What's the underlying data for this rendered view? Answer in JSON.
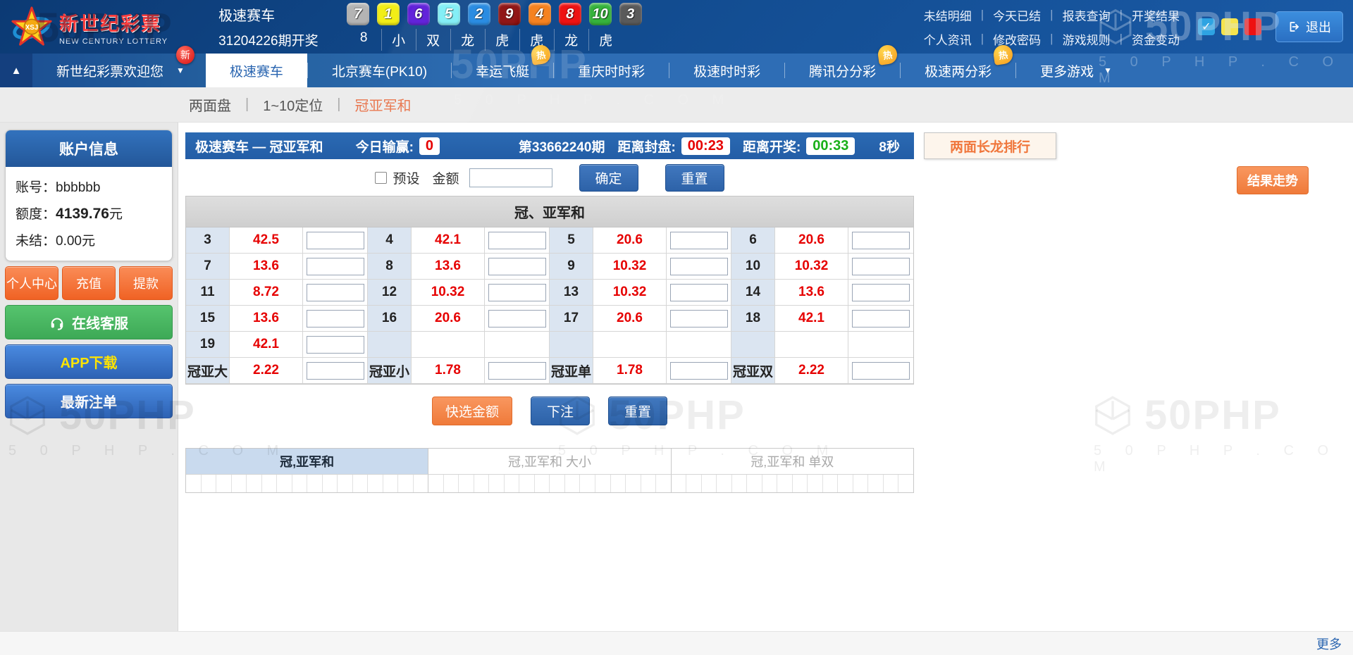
{
  "watermark": {
    "text": "50PHP",
    "sub": "5 0 P H P . C O M"
  },
  "header": {
    "logo": {
      "badge": "XSJ",
      "title": "新世纪彩票",
      "subtitle": "NEW CENTURY LOTTERY"
    },
    "game_name": "极速赛车",
    "draw_label": "31204226期开奖",
    "balls": [
      {
        "num": "7",
        "color": "#b4b4b4"
      },
      {
        "num": "1",
        "color": "#f2ee16"
      },
      {
        "num": "6",
        "color": "#5a17d8"
      },
      {
        "num": "5",
        "color": "#7deef5"
      },
      {
        "num": "2",
        "color": "#1f86e0"
      },
      {
        "num": "9",
        "color": "#8b0a0a"
      },
      {
        "num": "4",
        "color": "#f58220"
      },
      {
        "num": "8",
        "color": "#ee1212"
      },
      {
        "num": "10",
        "color": "#36b33c"
      },
      {
        "num": "3",
        "color": "#5a5a5a"
      }
    ],
    "results": [
      "8",
      "小",
      "双",
      "龙",
      "虎",
      "虎",
      "龙",
      "虎"
    ],
    "links_row1": [
      "未结明细",
      "今天已结",
      "报表查询",
      "开奖结果"
    ],
    "links_row2": [
      "个人资讯",
      "修改密码",
      "游戏规则",
      "资金变动"
    ],
    "theme_colors": [
      "#2ea3e2",
      "#f5e44e",
      "#ee1111"
    ],
    "logout_label": "退出"
  },
  "nav": {
    "collapse_icon": "▲",
    "welcome": "新世纪彩票欢迎您",
    "welcome_badge": "新",
    "tabs": [
      {
        "label": "极速赛车",
        "active": true
      },
      {
        "label": "北京赛车(PK10)"
      },
      {
        "label": "幸运飞艇",
        "hot": "热"
      },
      {
        "label": "重庆时时彩"
      },
      {
        "label": "极速时时彩"
      },
      {
        "label": "腾讯分分彩",
        "hot": "热"
      },
      {
        "label": "极速两分彩",
        "hot": "热"
      },
      {
        "label": "更多游戏",
        "caret": true
      }
    ]
  },
  "subnav": {
    "items": [
      {
        "label": "两面盘"
      },
      {
        "label": "1~10定位"
      },
      {
        "label": "冠亚军和",
        "active": true
      }
    ]
  },
  "sidebar": {
    "panel_title": "账户信息",
    "fields": [
      {
        "label": "账号：",
        "value": "bbbbbb",
        "suffix": "",
        "bold": false
      },
      {
        "label": "额度：",
        "value": "4139.76",
        "suffix": " 元",
        "bold": true
      },
      {
        "label": "未结：",
        "value": "0.00",
        "suffix": " 元",
        "bold": false
      }
    ],
    "buttons": [
      "个人中心",
      "充值",
      "提款"
    ],
    "service_button": "在线客服",
    "app_button": "APP下载",
    "orders_button": "最新注单"
  },
  "game_bar": {
    "title": "极速赛车 — 冠亚军和",
    "today_label": "今日输赢:",
    "today_value": "0",
    "period": "第33662240期",
    "close_label": "距离封盘:",
    "close_time": "00:23",
    "open_label": "距离开奖:",
    "open_time": "00:33",
    "seconds": "8秒",
    "dragon_button": "两面长龙排行"
  },
  "bet_controls": {
    "preset_label": "预设",
    "amount_label": "金额",
    "confirm": "确定",
    "reset": "重置",
    "trend_button": "结果走势"
  },
  "bet_table": {
    "title": "冠、亚军和",
    "rows": [
      [
        {
          "label": "3",
          "odds": "42.5"
        },
        {
          "label": "4",
          "odds": "42.1"
        },
        {
          "label": "5",
          "odds": "20.6"
        },
        {
          "label": "6",
          "odds": "20.6"
        }
      ],
      [
        {
          "label": "7",
          "odds": "13.6"
        },
        {
          "label": "8",
          "odds": "13.6"
        },
        {
          "label": "9",
          "odds": "10.32"
        },
        {
          "label": "10",
          "odds": "10.32"
        }
      ],
      [
        {
          "label": "11",
          "odds": "8.72"
        },
        {
          "label": "12",
          "odds": "10.32"
        },
        {
          "label": "13",
          "odds": "10.32"
        },
        {
          "label": "14",
          "odds": "13.6"
        }
      ],
      [
        {
          "label": "15",
          "odds": "13.6"
        },
        {
          "label": "16",
          "odds": "20.6"
        },
        {
          "label": "17",
          "odds": "20.6"
        },
        {
          "label": "18",
          "odds": "42.1"
        }
      ],
      [
        {
          "label": "19",
          "odds": "42.1"
        },
        null,
        null,
        null
      ],
      [
        {
          "label": "冠亚大",
          "odds": "2.22"
        },
        {
          "label": "冠亚小",
          "odds": "1.78"
        },
        {
          "label": "冠亚单",
          "odds": "1.78"
        },
        {
          "label": "冠亚双",
          "odds": "2.22"
        }
      ]
    ],
    "quick_amount": "快选金额",
    "bet": "下注",
    "reset": "重置"
  },
  "trend_table": {
    "sections": [
      {
        "label": "冠,亚军和",
        "active": true
      },
      {
        "label": "冠,亚军和 大小",
        "active": false
      },
      {
        "label": "冠,亚军和 单双",
        "active": false
      }
    ],
    "cells_per_section": 16
  },
  "footer": {
    "more": "更多"
  }
}
